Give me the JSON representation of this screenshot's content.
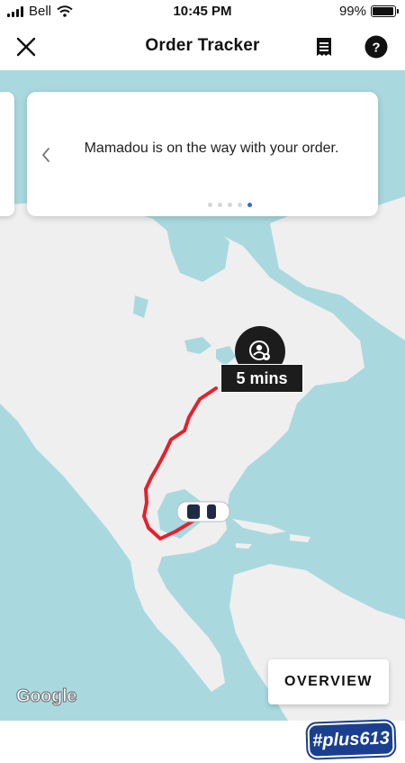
{
  "status_bar": {
    "carrier": "Bell",
    "time": "10:45 PM",
    "battery_percent": "99%",
    "battery_level": 0.99
  },
  "header": {
    "title": "Order Tracker",
    "close_icon": "close-icon",
    "receipt_icon": "receipt-icon",
    "help_icon": "help-icon"
  },
  "notification_card": {
    "message": "Mamadou is on the way with your order.",
    "page_count": 5,
    "active_page": 5
  },
  "map": {
    "eta_label": "5 mins",
    "destination_icon": "courier-location-pin-icon",
    "vehicle_icon": "car-icon",
    "route_color": "#e5202e",
    "water_color": "#a9d9df",
    "land_color": "#efefef",
    "overview_button": "OVERVIEW",
    "attribution": "Google"
  },
  "watermark": {
    "text": "#plus613"
  }
}
